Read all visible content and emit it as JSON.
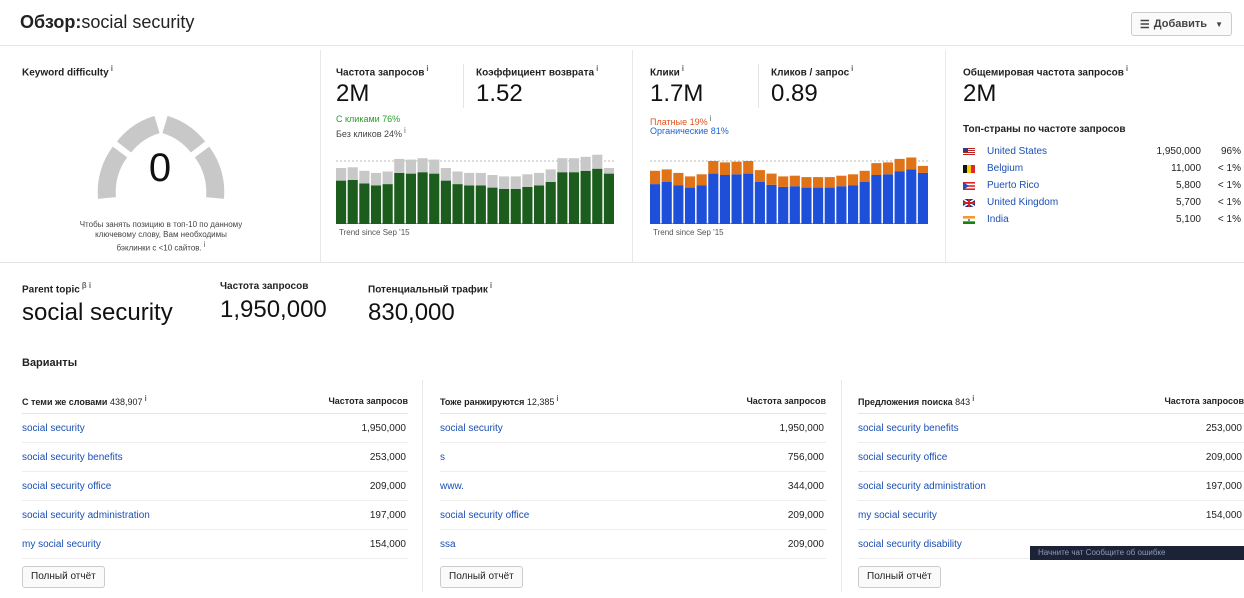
{
  "header": {
    "title_prefix": "Обзор:",
    "title_keyword": "social security",
    "add_button": "Добавить"
  },
  "kd": {
    "label": "Keyword difficulty",
    "value": "0",
    "note": "Чтобы занять позицию в топ-10 по данному ключевому слову, Вам необходимы бэклинки с <10 сайтов."
  },
  "volume": {
    "label": "Частота запросов",
    "value": "2M",
    "rr_label": "Коэффициент возврата",
    "rr_value": "1.52",
    "with_clicks": "С кликами 76%",
    "without_clicks": "Без кликов 24%",
    "trend": "Trend since Sep '15",
    "bars_clicks": [
      0.62,
      0.63,
      0.58,
      0.55,
      0.57,
      0.73,
      0.72,
      0.74,
      0.72,
      0.62,
      0.57,
      0.55,
      0.55,
      0.52,
      0.5,
      0.5,
      0.53,
      0.55,
      0.6,
      0.74,
      0.74,
      0.76,
      0.79,
      0.72
    ],
    "bars_noclicks": [
      0.18,
      0.18,
      0.18,
      0.18,
      0.18,
      0.2,
      0.2,
      0.2,
      0.2,
      0.18,
      0.18,
      0.18,
      0.18,
      0.18,
      0.18,
      0.18,
      0.18,
      0.18,
      0.18,
      0.2,
      0.2,
      0.2,
      0.2,
      0.08
    ],
    "colors": {
      "clicks": "#1c5c1c",
      "noclicks": "#c8c8c8"
    }
  },
  "clicks": {
    "label": "Клики",
    "value": "1.7M",
    "cpq_label": "Кликов / запрос",
    "cpq_value": "0.89",
    "paid": "Платные 19%",
    "organic": "Органические 81%",
    "trend": "Trend since Sep '15",
    "bars_organic": [
      0.57,
      0.6,
      0.55,
      0.52,
      0.55,
      0.72,
      0.7,
      0.71,
      0.72,
      0.6,
      0.56,
      0.53,
      0.54,
      0.52,
      0.52,
      0.52,
      0.54,
      0.55,
      0.6,
      0.7,
      0.71,
      0.75,
      0.78,
      0.73
    ],
    "bars_paid": [
      0.19,
      0.18,
      0.18,
      0.16,
      0.16,
      0.18,
      0.18,
      0.18,
      0.18,
      0.17,
      0.16,
      0.15,
      0.15,
      0.15,
      0.15,
      0.15,
      0.15,
      0.16,
      0.16,
      0.17,
      0.17,
      0.18,
      0.17,
      0.1
    ],
    "colors": {
      "organic": "#1e4fd8",
      "paid": "#e07318"
    }
  },
  "global": {
    "label": "Общемировая частота запросов",
    "value": "2M",
    "top_label": "Топ-страны по частоте запросов",
    "countries": [
      {
        "name": "United States",
        "volume": "1,950,000",
        "pct": "96%",
        "flag": "us"
      },
      {
        "name": "Belgium",
        "volume": "11,000",
        "pct": "< 1%",
        "flag": "be"
      },
      {
        "name": "Puerto Rico",
        "volume": "5,800",
        "pct": "< 1%",
        "flag": "pr"
      },
      {
        "name": "United Kingdom",
        "volume": "5,700",
        "pct": "< 1%",
        "flag": "gb"
      },
      {
        "name": "India",
        "volume": "5,100",
        "pct": "< 1%",
        "flag": "in"
      }
    ]
  },
  "parent": {
    "label": "Parent topic",
    "value": "social security",
    "vol_label": "Частота запросов",
    "vol_value": "1,950,000",
    "traffic_label": "Потенциальный трафик",
    "traffic_value": "830,000"
  },
  "variants": {
    "title": "Варианты",
    "full_report": "Полный отчёт",
    "volume_header": "Частота запросов",
    "columns": [
      {
        "title": "С теми же словами",
        "count": "438,907",
        "rows": [
          {
            "kw": "social security",
            "vol": "1,950,000"
          },
          {
            "kw": "social security benefits",
            "vol": "253,000"
          },
          {
            "kw": "social security office",
            "vol": "209,000"
          },
          {
            "kw": "social security administration",
            "vol": "197,000"
          },
          {
            "kw": "my social security",
            "vol": "154,000"
          }
        ]
      },
      {
        "title": "Тоже ранжируются",
        "count": "12,385",
        "rows": [
          {
            "kw": "social security",
            "vol": "1,950,000"
          },
          {
            "kw": "s",
            "vol": "756,000"
          },
          {
            "kw": "www.",
            "vol": "344,000"
          },
          {
            "kw": "social security office",
            "vol": "209,000"
          },
          {
            "kw": "ssa",
            "vol": "209,000"
          }
        ]
      },
      {
        "title": "Предложения поиска",
        "count": "843",
        "rows": [
          {
            "kw": "social security benefits",
            "vol": "253,000"
          },
          {
            "kw": "social security office",
            "vol": "209,000"
          },
          {
            "kw": "social security administration",
            "vol": "197,000"
          },
          {
            "kw": "my social security",
            "vol": "154,000"
          },
          {
            "kw": "social security disability",
            "vol": ""
          }
        ]
      }
    ]
  },
  "toast": "Начните чат     Сообщите об ошибке"
}
